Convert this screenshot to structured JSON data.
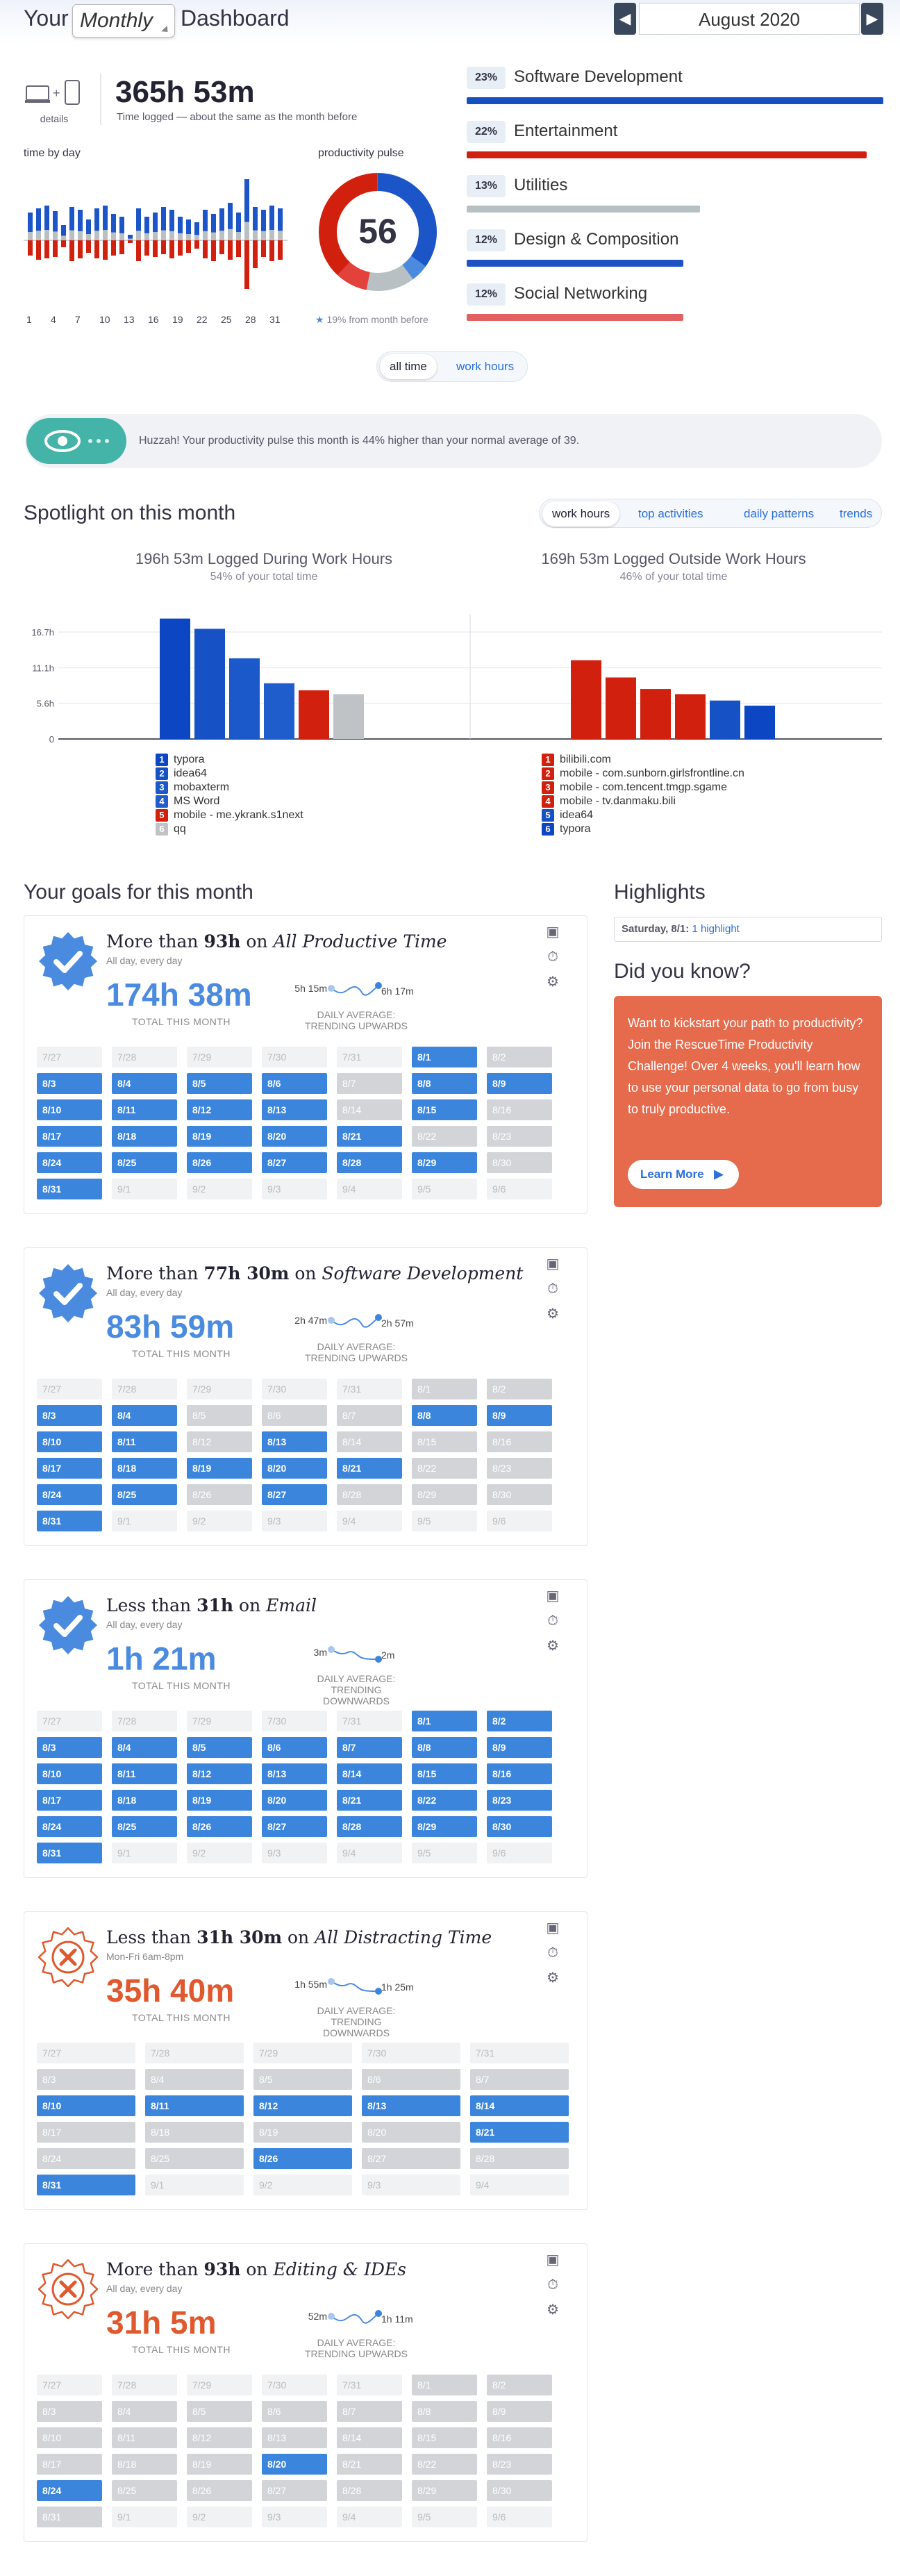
{
  "header": {
    "title_prefix": "Your",
    "period": "Monthly",
    "title_suffix": "Dashboard",
    "month": "August 2020",
    "prev_icon": "chevron-left-icon",
    "next_icon": "chevron-right-icon"
  },
  "summary": {
    "details_label": "details",
    "total_time": "365h 53m",
    "total_caption": "Time logged — about the same as the month before"
  },
  "time_by_day": {
    "label": "time by day",
    "ticks": [
      "1",
      "4",
      "7",
      "10",
      "13",
      "16",
      "19",
      "22",
      "25",
      "28",
      "31"
    ]
  },
  "pulse": {
    "label": "productivity pulse",
    "score": "56",
    "change": "19% from month before"
  },
  "categories": [
    {
      "pct": "23%",
      "name": "Software Development",
      "color": "#1650c0",
      "fill": 1.0
    },
    {
      "pct": "22%",
      "name": "Entertainment",
      "color": "#d2200f",
      "fill": 0.96
    },
    {
      "pct": "13%",
      "name": "Utilities",
      "color": "#b7c1c4",
      "fill": 0.56
    },
    {
      "pct": "12%",
      "name": "Design & Composition",
      "color": "#1e52c4",
      "fill": 0.52
    },
    {
      "pct": "12%",
      "name": "Social Networking",
      "color": "#e36063",
      "fill": 0.52
    }
  ],
  "time_toggle": {
    "all": "all time",
    "work": "work hours"
  },
  "banner": {
    "text": "Huzzah! Your productivity pulse this month is 44% higher than your normal average of 39.",
    "icon": "eye-icon"
  },
  "spotlight": {
    "title": "Spotlight on this month",
    "tabs": [
      "work hours",
      "top activities",
      "daily patterns",
      "trends"
    ],
    "left_title": "196h 53m Logged During Work Hours",
    "left_sub": "54% of your total time",
    "right_title": "169h 53m Logged Outside Work Hours",
    "right_sub": "46% of your total time",
    "y_ticks": [
      "16.7h",
      "11.1h",
      "5.6h",
      "0"
    ],
    "left_legend": [
      "typora",
      "idea64",
      "mobaxterm",
      "MS Word",
      "mobile - me.ykrank.s1next",
      "qq"
    ],
    "right_legend": [
      "bilibili.com",
      "mobile - com.sunborn.girlsfrontline.cn",
      "mobile - com.tencent.tmgp.sgame",
      "mobile - tv.danmaku.bili",
      "idea64",
      "typora"
    ]
  },
  "chart_data": {
    "type": "bar",
    "y_unit": "hours",
    "ylim": [
      0,
      18
    ],
    "y_ticks": [
      0,
      5.6,
      11.1,
      16.7
    ],
    "left": {
      "categories": [
        "typora",
        "idea64",
        "mobaxterm",
        "MS Word",
        "mobile - me.ykrank.s1next",
        "qq"
      ],
      "values": [
        18.8,
        17.2,
        12.6,
        8.7,
        7.6,
        7.0
      ],
      "colors": [
        "#0c46c2",
        "#1652c6",
        "#1b58c9",
        "#1f5dcc",
        "#d2200f",
        "#c0c3c5"
      ]
    },
    "right": {
      "categories": [
        "bilibili.com",
        "mobile - com.sunborn.girlsfrontline.cn",
        "mobile - com.tencent.tmgp.sgame",
        "mobile - tv.danmaku.bili",
        "idea64",
        "typora"
      ],
      "values": [
        12.3,
        9.6,
        7.8,
        7.0,
        6.0,
        5.2
      ],
      "colors": [
        "#d2200f",
        "#d2200f",
        "#d2200f",
        "#d2200f",
        "#1652c6",
        "#0c46c2"
      ]
    }
  },
  "goals_title": "Your goals for this month",
  "goals": [
    {
      "status": "achieved",
      "prefix": "More than ",
      "amount": "93h",
      "on": " on ",
      "target": "All Productive Time",
      "schedule": "All day, every day",
      "total": "174h 38m",
      "total_label": "TOTAL THIS MONTH",
      "spark_start": "5h 15m",
      "spark_end": "6h 17m",
      "trend": [
        "DAILY AVERAGE:",
        "TRENDING UPWARDS"
      ],
      "cols": 7,
      "days": [
        [
          "7/27",
          "e"
        ],
        [
          "7/28",
          "e"
        ],
        [
          "7/29",
          "e"
        ],
        [
          "7/30",
          "e"
        ],
        [
          "7/31",
          "e"
        ],
        [
          "8/1",
          "b"
        ],
        [
          "8/2",
          "g"
        ],
        [
          "8/3",
          "b"
        ],
        [
          "8/4",
          "b"
        ],
        [
          "8/5",
          "b"
        ],
        [
          "8/6",
          "b"
        ],
        [
          "8/7",
          "g"
        ],
        [
          "8/8",
          "b"
        ],
        [
          "8/9",
          "b"
        ],
        [
          "8/10",
          "b"
        ],
        [
          "8/11",
          "b"
        ],
        [
          "8/12",
          "b"
        ],
        [
          "8/13",
          "b"
        ],
        [
          "8/14",
          "g"
        ],
        [
          "8/15",
          "b"
        ],
        [
          "8/16",
          "g"
        ],
        [
          "8/17",
          "b"
        ],
        [
          "8/18",
          "b"
        ],
        [
          "8/19",
          "b"
        ],
        [
          "8/20",
          "b"
        ],
        [
          "8/21",
          "b"
        ],
        [
          "8/22",
          "g"
        ],
        [
          "8/23",
          "g"
        ],
        [
          "8/24",
          "b"
        ],
        [
          "8/25",
          "b"
        ],
        [
          "8/26",
          "b"
        ],
        [
          "8/27",
          "b"
        ],
        [
          "8/28",
          "b"
        ],
        [
          "8/29",
          "b"
        ],
        [
          "8/30",
          "g"
        ],
        [
          "8/31",
          "b"
        ],
        [
          "9/1",
          "e"
        ],
        [
          "9/2",
          "e"
        ],
        [
          "9/3",
          "e"
        ],
        [
          "9/4",
          "e"
        ],
        [
          "9/5",
          "e"
        ],
        [
          "9/6",
          "e"
        ]
      ]
    },
    {
      "status": "achieved",
      "prefix": "More than ",
      "amount": "77h 30m",
      "on": " on ",
      "target": "Software Development",
      "schedule": "All day, every day",
      "total": "83h 59m",
      "total_label": "TOTAL THIS MONTH",
      "spark_start": "2h 47m",
      "spark_end": "2h 57m",
      "trend": [
        "DAILY AVERAGE:",
        "TRENDING UPWARDS"
      ],
      "cols": 7,
      "days": [
        [
          "7/27",
          "e"
        ],
        [
          "7/28",
          "e"
        ],
        [
          "7/29",
          "e"
        ],
        [
          "7/30",
          "e"
        ],
        [
          "7/31",
          "e"
        ],
        [
          "8/1",
          "g"
        ],
        [
          "8/2",
          "g"
        ],
        [
          "8/3",
          "b"
        ],
        [
          "8/4",
          "b"
        ],
        [
          "8/5",
          "g"
        ],
        [
          "8/6",
          "g"
        ],
        [
          "8/7",
          "g"
        ],
        [
          "8/8",
          "b"
        ],
        [
          "8/9",
          "b"
        ],
        [
          "8/10",
          "b"
        ],
        [
          "8/11",
          "b"
        ],
        [
          "8/12",
          "g"
        ],
        [
          "8/13",
          "b"
        ],
        [
          "8/14",
          "g"
        ],
        [
          "8/15",
          "g"
        ],
        [
          "8/16",
          "g"
        ],
        [
          "8/17",
          "b"
        ],
        [
          "8/18",
          "b"
        ],
        [
          "8/19",
          "b"
        ],
        [
          "8/20",
          "b"
        ],
        [
          "8/21",
          "b"
        ],
        [
          "8/22",
          "g"
        ],
        [
          "8/23",
          "g"
        ],
        [
          "8/24",
          "b"
        ],
        [
          "8/25",
          "b"
        ],
        [
          "8/26",
          "g"
        ],
        [
          "8/27",
          "b"
        ],
        [
          "8/28",
          "g"
        ],
        [
          "8/29",
          "g"
        ],
        [
          "8/30",
          "g"
        ],
        [
          "8/31",
          "b"
        ],
        [
          "9/1",
          "e"
        ],
        [
          "9/2",
          "e"
        ],
        [
          "9/3",
          "e"
        ],
        [
          "9/4",
          "e"
        ],
        [
          "9/5",
          "e"
        ],
        [
          "9/6",
          "e"
        ]
      ]
    },
    {
      "status": "achieved",
      "prefix": "Less than ",
      "amount": "31h",
      "on": " on ",
      "target": "Email",
      "schedule": "All day, every day",
      "total": "1h 21m",
      "total_label": "TOTAL THIS MONTH",
      "spark_start": "3m",
      "spark_end": "2m",
      "trend": [
        "DAILY AVERAGE:",
        "TRENDING DOWNWARDS"
      ],
      "cols": 7,
      "days": [
        [
          "7/27",
          "e"
        ],
        [
          "7/28",
          "e"
        ],
        [
          "7/29",
          "e"
        ],
        [
          "7/30",
          "e"
        ],
        [
          "7/31",
          "e"
        ],
        [
          "8/1",
          "b"
        ],
        [
          "8/2",
          "b"
        ],
        [
          "8/3",
          "b"
        ],
        [
          "8/4",
          "b"
        ],
        [
          "8/5",
          "b"
        ],
        [
          "8/6",
          "b"
        ],
        [
          "8/7",
          "b"
        ],
        [
          "8/8",
          "b"
        ],
        [
          "8/9",
          "b"
        ],
        [
          "8/10",
          "b"
        ],
        [
          "8/11",
          "b"
        ],
        [
          "8/12",
          "b"
        ],
        [
          "8/13",
          "b"
        ],
        [
          "8/14",
          "b"
        ],
        [
          "8/15",
          "b"
        ],
        [
          "8/16",
          "b"
        ],
        [
          "8/17",
          "b"
        ],
        [
          "8/18",
          "b"
        ],
        [
          "8/19",
          "b"
        ],
        [
          "8/20",
          "b"
        ],
        [
          "8/21",
          "b"
        ],
        [
          "8/22",
          "b"
        ],
        [
          "8/23",
          "b"
        ],
        [
          "8/24",
          "b"
        ],
        [
          "8/25",
          "b"
        ],
        [
          "8/26",
          "b"
        ],
        [
          "8/27",
          "b"
        ],
        [
          "8/28",
          "b"
        ],
        [
          "8/29",
          "b"
        ],
        [
          "8/30",
          "b"
        ],
        [
          "8/31",
          "b"
        ],
        [
          "9/1",
          "e"
        ],
        [
          "9/2",
          "e"
        ],
        [
          "9/3",
          "e"
        ],
        [
          "9/4",
          "e"
        ],
        [
          "9/5",
          "e"
        ],
        [
          "9/6",
          "e"
        ]
      ]
    },
    {
      "status": "missed",
      "prefix": "Less than ",
      "amount": "31h 30m",
      "on": " on ",
      "target": "All Distracting Time",
      "schedule": "Mon-Fri 6am-8pm",
      "total": "35h 40m",
      "total_label": "TOTAL THIS MONTH",
      "spark_start": "1h 55m",
      "spark_end": "1h 25m",
      "trend": [
        "DAILY AVERAGE:",
        "TRENDING DOWNWARDS"
      ],
      "cols": 5,
      "days": [
        [
          "7/27",
          "e"
        ],
        [
          "7/28",
          "e"
        ],
        [
          "7/29",
          "e"
        ],
        [
          "7/30",
          "e"
        ],
        [
          "7/31",
          "e"
        ],
        [
          "8/3",
          "g"
        ],
        [
          "8/4",
          "g"
        ],
        [
          "8/5",
          "g"
        ],
        [
          "8/6",
          "g"
        ],
        [
          "8/7",
          "g"
        ],
        [
          "8/10",
          "b"
        ],
        [
          "8/11",
          "b"
        ],
        [
          "8/12",
          "b"
        ],
        [
          "8/13",
          "b"
        ],
        [
          "8/14",
          "b"
        ],
        [
          "8/17",
          "g"
        ],
        [
          "8/18",
          "g"
        ],
        [
          "8/19",
          "g"
        ],
        [
          "8/20",
          "g"
        ],
        [
          "8/21",
          "b"
        ],
        [
          "8/24",
          "g"
        ],
        [
          "8/25",
          "g"
        ],
        [
          "8/26",
          "b"
        ],
        [
          "8/27",
          "g"
        ],
        [
          "8/28",
          "g"
        ],
        [
          "8/31",
          "b"
        ],
        [
          "9/1",
          "e"
        ],
        [
          "9/2",
          "e"
        ],
        [
          "9/3",
          "e"
        ],
        [
          "9/4",
          "e"
        ]
      ]
    },
    {
      "status": "missed",
      "prefix": "More than ",
      "amount": "93h",
      "on": " on ",
      "target": "Editing & IDEs",
      "schedule": "All day, every day",
      "total": "31h 5m",
      "total_label": "TOTAL THIS MONTH",
      "spark_start": "52m",
      "spark_end": "1h 11m",
      "trend": [
        "DAILY AVERAGE:",
        "TRENDING UPWARDS"
      ],
      "cols": 7,
      "days": [
        [
          "7/27",
          "e"
        ],
        [
          "7/28",
          "e"
        ],
        [
          "7/29",
          "e"
        ],
        [
          "7/30",
          "e"
        ],
        [
          "7/31",
          "e"
        ],
        [
          "8/1",
          "g"
        ],
        [
          "8/2",
          "g"
        ],
        [
          "8/3",
          "g"
        ],
        [
          "8/4",
          "g"
        ],
        [
          "8/5",
          "g"
        ],
        [
          "8/6",
          "g"
        ],
        [
          "8/7",
          "g"
        ],
        [
          "8/8",
          "g"
        ],
        [
          "8/9",
          "g"
        ],
        [
          "8/10",
          "g"
        ],
        [
          "8/11",
          "g"
        ],
        [
          "8/12",
          "g"
        ],
        [
          "8/13",
          "g"
        ],
        [
          "8/14",
          "g"
        ],
        [
          "8/15",
          "g"
        ],
        [
          "8/16",
          "g"
        ],
        [
          "8/17",
          "g"
        ],
        [
          "8/18",
          "g"
        ],
        [
          "8/19",
          "g"
        ],
        [
          "8/20",
          "b"
        ],
        [
          "8/21",
          "g"
        ],
        [
          "8/22",
          "g"
        ],
        [
          "8/23",
          "g"
        ],
        [
          "8/24",
          "b"
        ],
        [
          "8/25",
          "g"
        ],
        [
          "8/26",
          "g"
        ],
        [
          "8/27",
          "g"
        ],
        [
          "8/28",
          "g"
        ],
        [
          "8/29",
          "g"
        ],
        [
          "8/30",
          "g"
        ],
        [
          "8/31",
          "g"
        ],
        [
          "9/1",
          "e"
        ],
        [
          "9/2",
          "e"
        ],
        [
          "9/3",
          "e"
        ],
        [
          "9/4",
          "e"
        ],
        [
          "9/5",
          "e"
        ],
        [
          "9/6",
          "e"
        ]
      ]
    }
  ],
  "highlights": {
    "title": "Highlights",
    "day": "Saturday, 8/1:",
    "count": "1 highlight"
  },
  "did_you_know": {
    "title": "Did you know?",
    "text": "Want to kickstart your path to productivity? Join the RescueTime Productivity Challenge! Over 4 weeks, you'll learn how to use your personal data to go from busy to truly productive.",
    "button": "Learn More"
  }
}
